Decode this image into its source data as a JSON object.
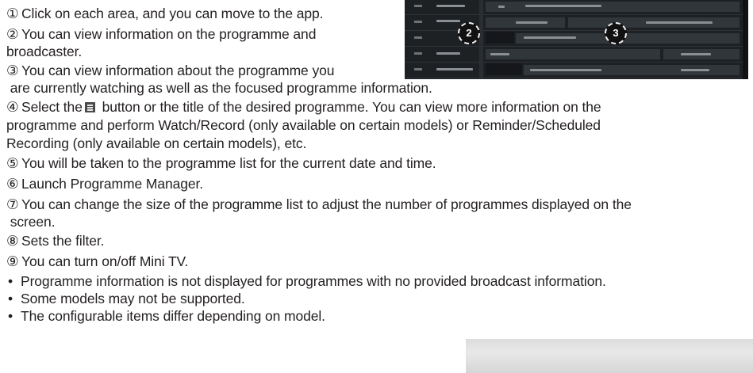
{
  "items": [
    {
      "num": "①",
      "lines": [
        "Click on each area, and you can move to the app."
      ]
    },
    {
      "num": "②",
      "lines": [
        "You can view information on the programme and",
        "broadcaster."
      ]
    },
    {
      "num": "③",
      "lines": [
        "You can view information about the programme you",
        " are currently watching as well as the focused programme information."
      ]
    },
    {
      "num": "④",
      "pre": "Select the",
      "icon": "menu-icon",
      "post": " button or the title of the desired programme. You can view more information on the",
      "lines": [
        "programme and perform Watch/Record (only available on certain models) or Reminder/Scheduled",
        "Recording (only available on certain models), etc."
      ]
    },
    {
      "num": "⑤",
      "lines": [
        "You will be taken to the programme list for the current date and time."
      ]
    },
    {
      "num": "⑥",
      "lines": [
        "Launch Programme Manager."
      ]
    },
    {
      "num": "⑦",
      "lines": [
        "You can change the size of the programme list to adjust the number of programmes displayed on the",
        " screen."
      ]
    },
    {
      "num": "⑧",
      "lines": [
        "Sets the filter."
      ]
    },
    {
      "num": "⑨",
      "lines": [
        "You can turn on/off Mini TV."
      ]
    }
  ],
  "notes": [
    "Programme information is not displayed for programmes with no provided broadcast information.",
    "Some models may not be supported.",
    "The configurable items differ depending on model."
  ],
  "bullet_char": "•",
  "guide_callouts": [
    "2",
    "3"
  ],
  "colors": {
    "text": "#231f20",
    "guide_bg": "#1e2124",
    "icon": "#4b4b4b"
  }
}
